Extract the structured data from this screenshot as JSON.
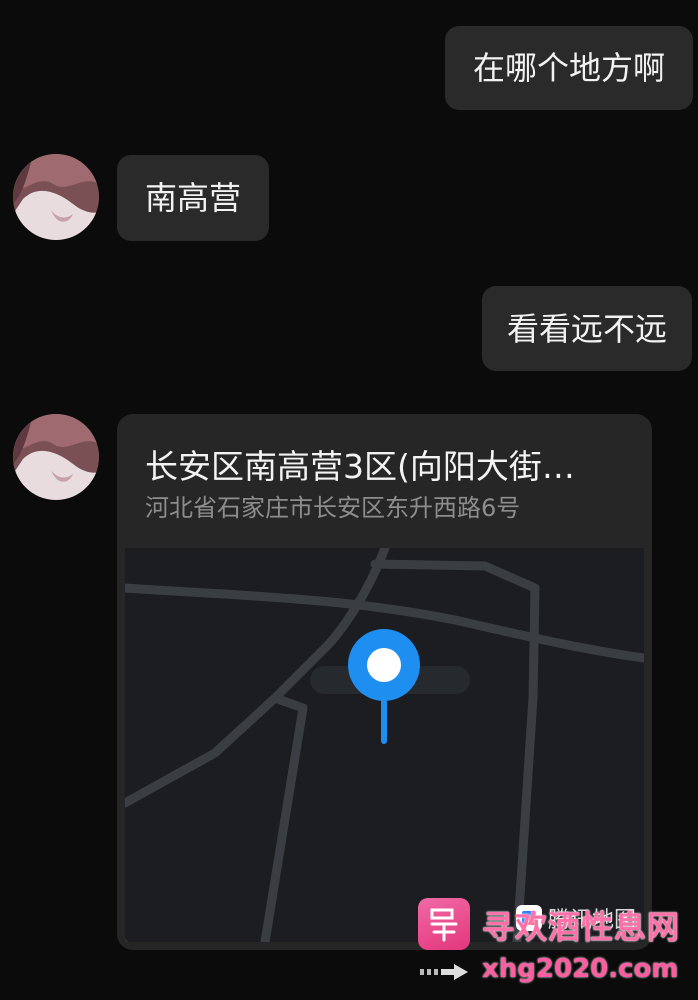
{
  "messages": {
    "outgoing_1": "在哪个地方啊",
    "incoming_1": "南高营",
    "outgoing_2": "看看远不远"
  },
  "location_card": {
    "title": "长安区南高营3区(向阳大街…",
    "address": "河北省石家庄市长安区东升西路6号",
    "map_provider_label": "腾讯地图",
    "pin_icon": "location-pin-icon"
  },
  "watermark": {
    "site_name": "寻欢酒性息网",
    "url": "xhg2020.com"
  },
  "colors": {
    "background": "#0b0b0b",
    "bubble": "#2a2a2a",
    "pin": "#1f8ef1",
    "watermark_pink": "#ff6fa8"
  }
}
